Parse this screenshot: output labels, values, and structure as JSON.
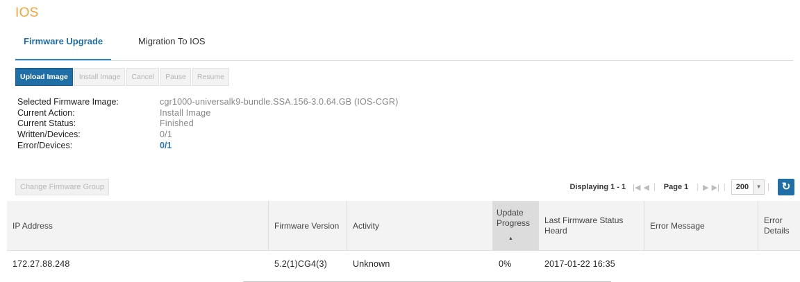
{
  "page": {
    "title": "IOS"
  },
  "tabs": [
    {
      "label": "Firmware Upgrade",
      "active": true
    },
    {
      "label": "Migration To IOS",
      "active": false
    }
  ],
  "toolbar": {
    "upload_label": "Upload Image",
    "install_label": "Install Image",
    "cancel_label": "Cancel",
    "pause_label": "Pause",
    "resume_label": "Resume"
  },
  "info": [
    {
      "label": "Selected Firmware Image:",
      "value": "cgr1000-universalk9-bundle.SSA.156-3.0.64.GB (IOS-CGR)"
    },
    {
      "label": "Current Action:",
      "value": "Install Image"
    },
    {
      "label": "Current Status:",
      "value": "Finished"
    },
    {
      "label": "Written/Devices:",
      "value": "0/1"
    },
    {
      "label": "Error/Devices:",
      "value": "0/1"
    }
  ],
  "change_group_label": "Change Firmware Group",
  "pager": {
    "displaying": "Displaying 1 - 1",
    "page_label": "Page 1",
    "page_size": "200"
  },
  "grid": {
    "columns": [
      {
        "label": "IP Address"
      },
      {
        "label": "Firmware Version"
      },
      {
        "label": "Activity"
      },
      {
        "label": "Update Progress",
        "sorted": "ascending"
      },
      {
        "label": "Last Firmware Status Heard"
      },
      {
        "label": "Error Message"
      },
      {
        "label": "Error Details"
      }
    ],
    "rows": [
      {
        "ip": "172.27.88.248",
        "firmware": "5.2(1)CG4(3)",
        "activity": "Unknown",
        "progress": "0%",
        "last_heard": "2017-01-22 16:35",
        "error_message": "",
        "error_details": ""
      }
    ]
  },
  "colors": {
    "title": "#f3a23a",
    "primary": "#1f6ea6",
    "link": "#2d7bb5"
  },
  "icons": [
    "first-page-icon",
    "prev-page-icon",
    "next-page-icon",
    "last-page-icon",
    "dropdown-arrow-icon",
    "refresh-icon"
  ]
}
